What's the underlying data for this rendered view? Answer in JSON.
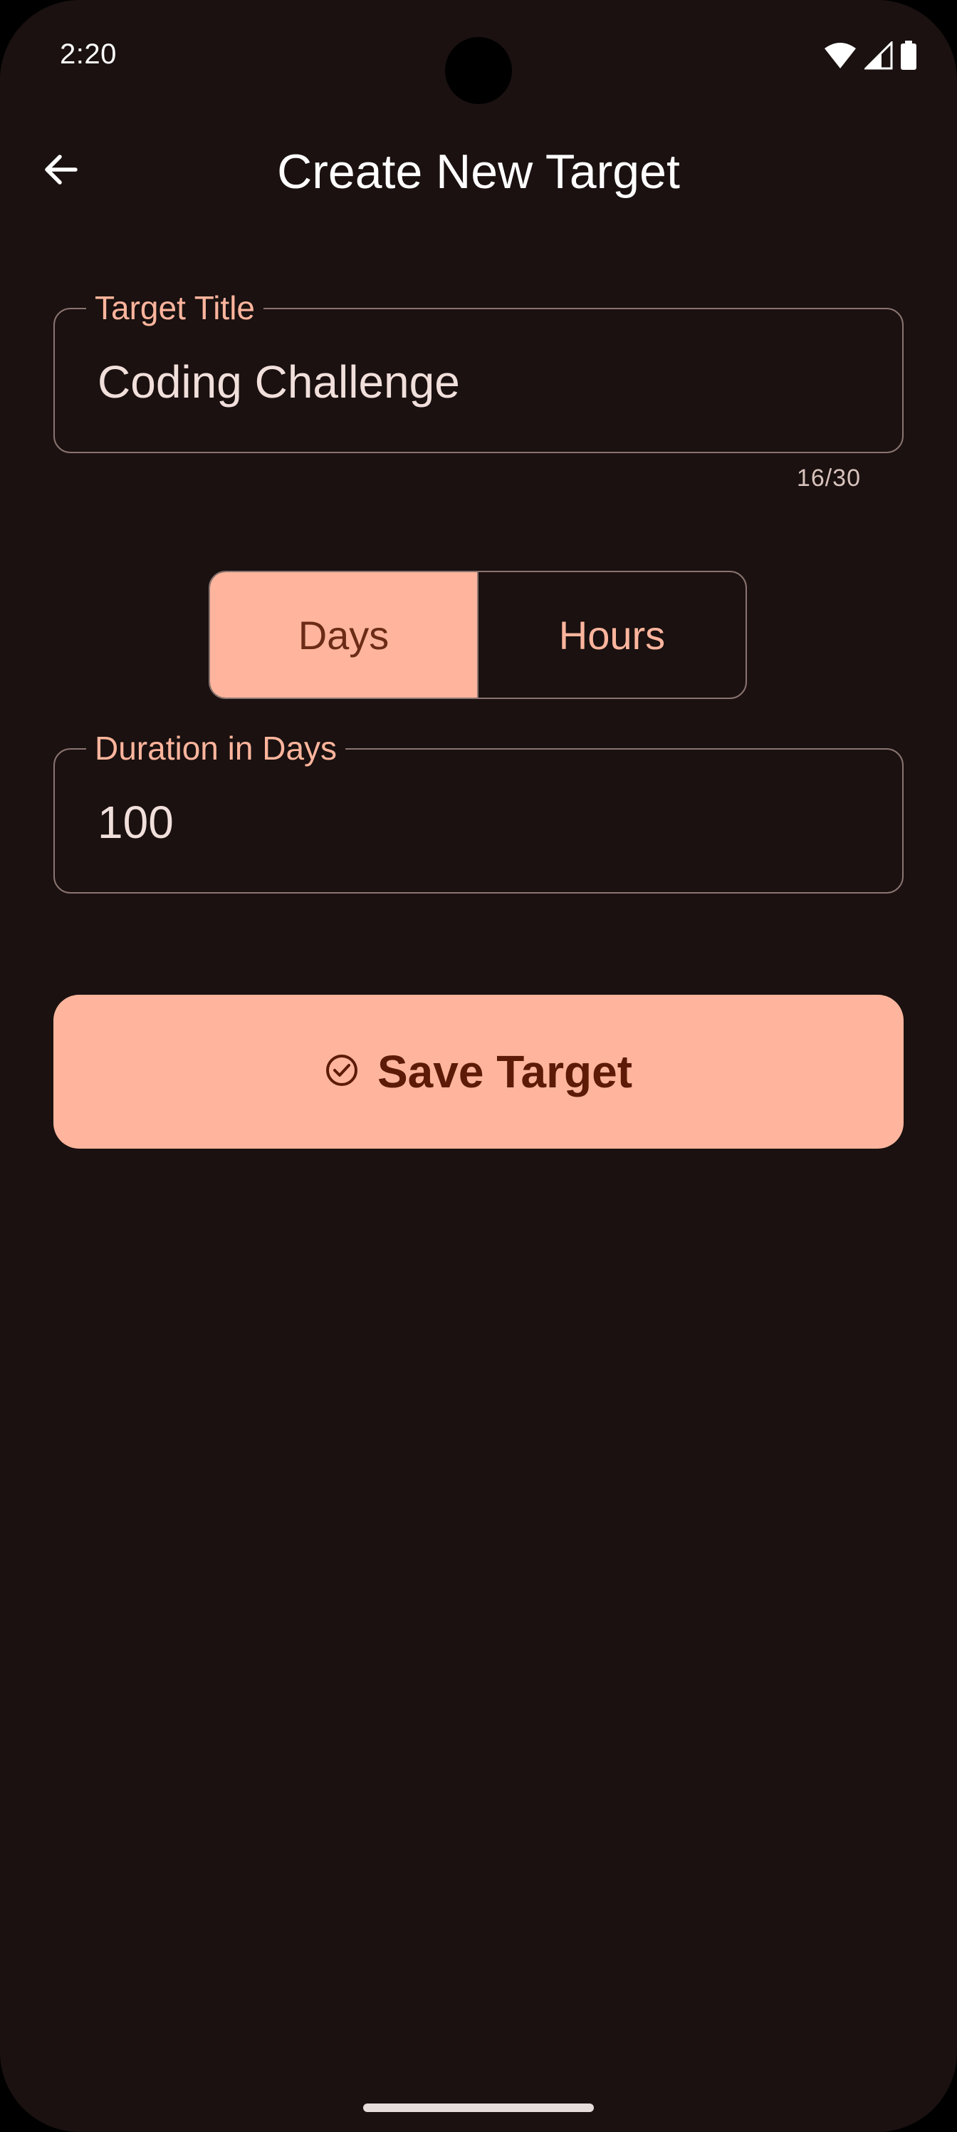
{
  "status_bar": {
    "time": "2:20",
    "icons": [
      "wifi-icon",
      "signal-icon",
      "battery-icon"
    ]
  },
  "app_bar": {
    "back_icon": "arrow-back-icon",
    "title": "Create New Target"
  },
  "form": {
    "title_field": {
      "label": "Target Title",
      "value": "Coding Challenge",
      "counter": "16/30"
    },
    "unit_toggle": {
      "options": [
        "Days",
        "Hours"
      ],
      "selected": "Days"
    },
    "duration_field": {
      "label": "Duration in Days",
      "value": "100"
    },
    "save_button": {
      "icon": "check-circle-icon",
      "label": "Save Target"
    }
  },
  "colors": {
    "background": "#1a1110",
    "accent": "#ffb59d",
    "on_accent": "#5c1a07",
    "outline": "#8a7470",
    "text": "#f1dfdb"
  }
}
